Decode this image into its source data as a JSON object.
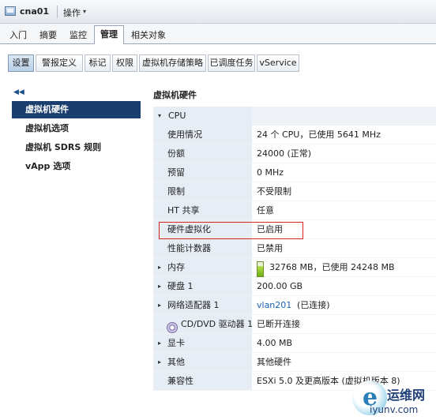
{
  "titlebar": {
    "vm_name": "cna01",
    "actions_label": "操作",
    "actions_caret": "▾"
  },
  "main_tabs": [
    "入门",
    "摘要",
    "监控",
    "管理",
    "相关对象"
  ],
  "active_main_tab": "管理",
  "sub_tabs": [
    "设置",
    "警报定义",
    "标记",
    "权限",
    "虚拟机存储策略",
    "已调度任务",
    "vService"
  ],
  "active_sub_tab": "设置",
  "left_nav": {
    "collapse_glyph": "◀◀",
    "items": [
      "虚拟机硬件",
      "虚拟机选项",
      "虚拟机 SDRS 规则",
      "vApp 选项"
    ],
    "active": "虚拟机硬件"
  },
  "section_title": "虚拟机硬件",
  "hardware": {
    "cpu": {
      "label": "CPU",
      "expanded": true,
      "rows": [
        {
          "label": "使用情况",
          "value": "24 个 CPU，已使用 5641 MHz"
        },
        {
          "label": "份额",
          "value": "24000 (正常)"
        },
        {
          "label": "预留",
          "value": "0 MHz"
        },
        {
          "label": "限制",
          "value": "不受限制"
        },
        {
          "label": "HT 共享",
          "value": "任意"
        },
        {
          "label": "硬件虚拟化",
          "value": "已启用"
        },
        {
          "label": "性能计数器",
          "value": "已禁用"
        }
      ]
    },
    "memory": {
      "label": "内存",
      "value": "32768 MB，已使用 24248 MB",
      "usage_fraction": 0.74
    },
    "disk": {
      "label": "硬盘 1",
      "value": "200.00 GB"
    },
    "network": {
      "label": "网络适配器 1",
      "network_link": "vlan201",
      "status": "(已连接)"
    },
    "cdrom": {
      "label": "CD/DVD 驱动器 1",
      "value": "已断开连接"
    },
    "video": {
      "label": "显卡",
      "value": "4.00 MB"
    },
    "other": {
      "label": "其他",
      "value": "其他硬件"
    },
    "compat": {
      "label": "兼容性",
      "value": "ESXi 5.0 及更高版本 (虚拟机版本 8)"
    }
  },
  "watermark": {
    "name": "运维网",
    "url": "iyunv.com"
  },
  "colors": {
    "active_nav": "#1a3e6e",
    "highlight_border": "#d9251d",
    "link": "#1b63b0"
  },
  "icons": {
    "collapse": "double-chevron-left-icon",
    "vm": "vm-icon",
    "cd": "cd-dvd-icon"
  }
}
